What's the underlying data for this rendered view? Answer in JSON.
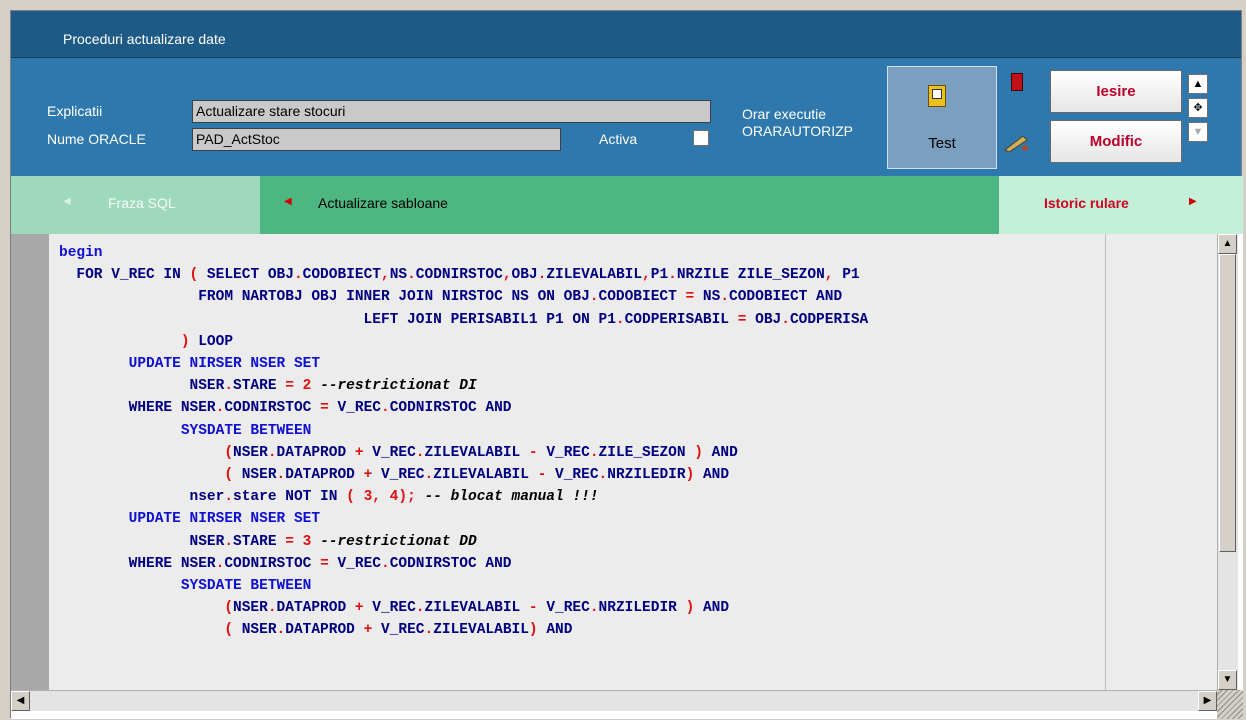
{
  "window": {
    "title": "Proceduri actualizare date"
  },
  "header": {
    "explicatii_label": "Explicatii",
    "explicatii_value": "Actualizare stare stocuri",
    "nume_oracle_label": "Nume ORACLE",
    "nume_oracle_value": "PAD_ActStoc",
    "activa_label": "Activa",
    "orar_label": "Orar executie",
    "orar_value": "ORARAUTORIZP",
    "test_label": "Test",
    "iesire_label": "Iesire",
    "modific_label": "Modific"
  },
  "tabs": [
    {
      "label": "Fraza SQL"
    },
    {
      "label": "Actualizare sabloane"
    },
    {
      "label": "Istoric rulare"
    }
  ],
  "colors": {
    "title_bar": "#1d5a86",
    "header": "#2f78ad",
    "tab_inactive": "#9ed9bd",
    "tab_active": "#4db681",
    "accent": "#b8002a"
  },
  "editor": {
    "lines": [
      "begin",
      "  FOR V_REC IN ( SELECT OBJ.CODOBIECT,NS.CODNIRSTOC,OBJ.ZILEVALABIL,P1.NRZILE ZILE_SEZON, P1",
      "                FROM NARTOBJ OBJ INNER JOIN NIRSTOC NS ON OBJ.CODOBIECT = NS.CODOBIECT AND",
      "                                   LEFT JOIN PERISABIL1 P1 ON P1.CODPERISABIL = OBJ.CODPERISA",
      "              ) LOOP",
      "        UPDATE NIRSER NSER SET",
      "               NSER.STARE = 2 --restrictionat DI",
      "        WHERE NSER.CODNIRSTOC = V_REC.CODNIRSTOC AND",
      "              SYSDATE BETWEEN",
      "                   (NSER.DATAPROD + V_REC.ZILEVALABIL - V_REC.ZILE_SEZON ) AND",
      "                   ( NSER.DATAPROD + V_REC.ZILEVALABIL - V_REC.NRZILEDIR) AND",
      "               nser.stare NOT IN ( 3, 4); -- blocat manual !!!",
      "        UPDATE NIRSER NSER SET",
      "               NSER.STARE = 3 --restrictionat DD",
      "        WHERE NSER.CODNIRSTOC = V_REC.CODNIRSTOC AND",
      "              SYSDATE BETWEEN",
      "                   (NSER.DATAPROD + V_REC.ZILEVALABIL - V_REC.NRZILEDIR ) AND",
      "                   ( NSER.DATAPROD + V_REC.ZILEVALABIL) AND"
    ]
  }
}
